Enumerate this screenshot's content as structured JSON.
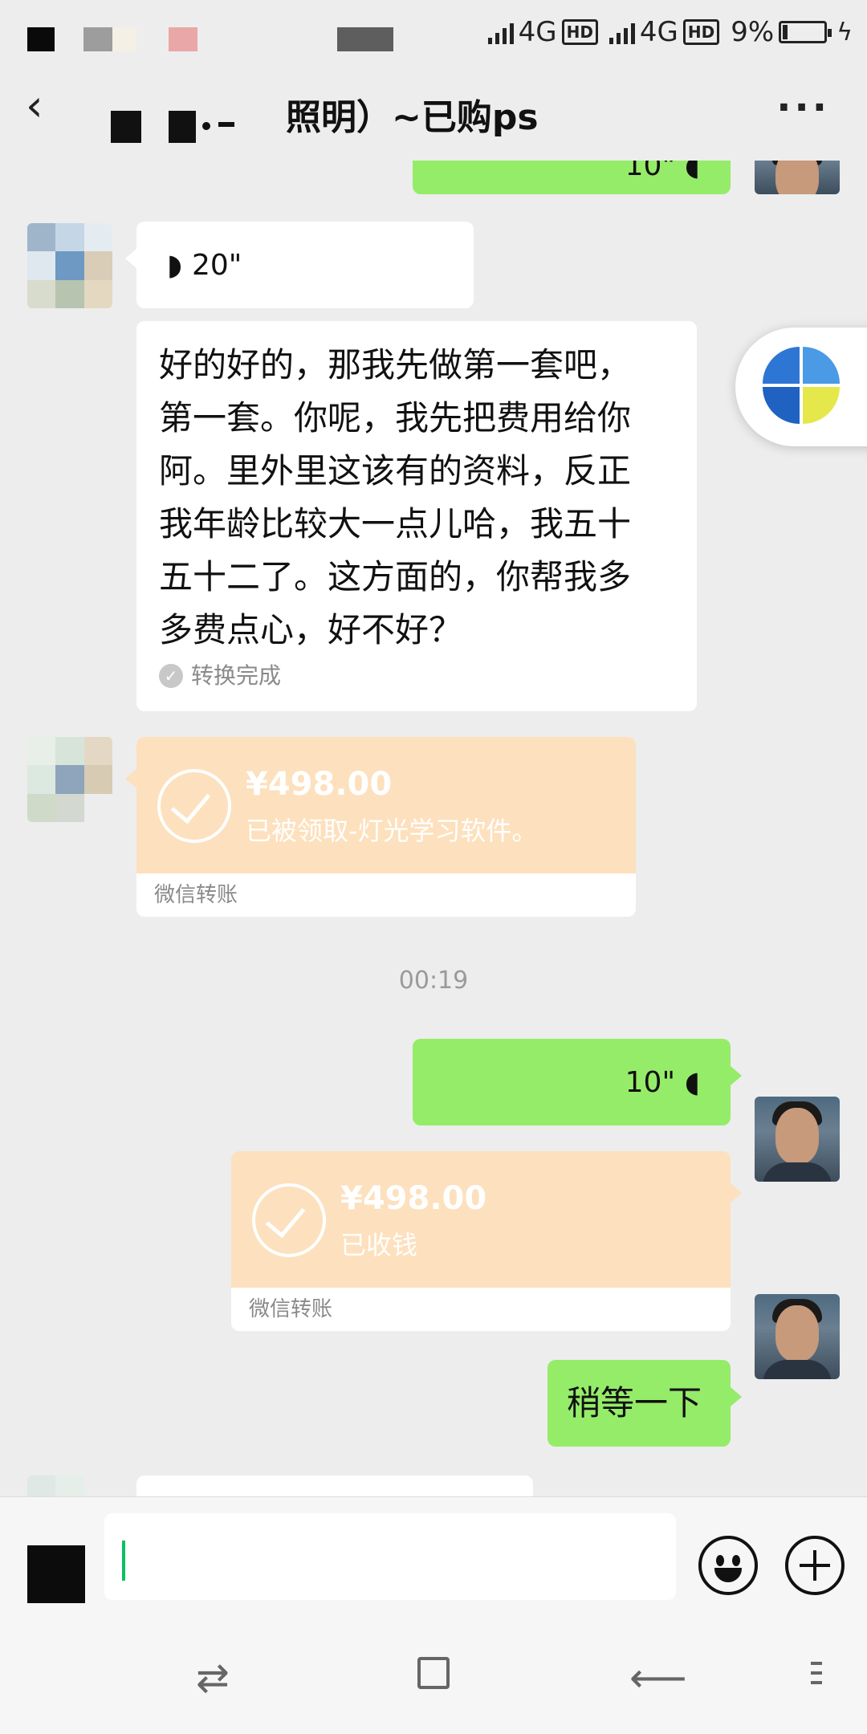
{
  "status_bar": {
    "network1": "4G",
    "hd1": "HD",
    "network2": "4G",
    "hd2": "HD",
    "battery_percent": "9%"
  },
  "title_bar": {
    "back_icon": "back-arrow-icon",
    "title": "照明）~已购ps",
    "more_label": "···"
  },
  "messages": {
    "voice_in": {
      "duration": "20\""
    },
    "text_in": {
      "lines": [
        "好的好的，那我先做第一套吧，",
        "第一套。你呢，我先把费用给你",
        "阿。里外里这该有的资料，反正",
        "我年龄比较大一点儿哈，我五十",
        "五十二了。这方面的，你帮我多",
        "多费点心，好不好？"
      ],
      "conversion_status": "转换完成"
    },
    "transfer_in": {
      "amount": "¥498.00",
      "note": "已被领取-灯光学习软件。",
      "footer": "微信转账"
    },
    "timestamp": "00:19",
    "voice_out": {
      "duration": "10\""
    },
    "transfer_out": {
      "amount": "¥498.00",
      "note": "已收钱",
      "footer": "微信转账"
    },
    "text_out": "稍等一下",
    "top_partial_voice_out": "10\""
  },
  "input_bar": {
    "voice_toggle_icon": "voice-keyboard-toggle-icon",
    "emoji_icon": "emoji-icon",
    "plus_icon": "plus-icon"
  },
  "nav_bar": {
    "switch_icon": "⇄",
    "back_icon": "⟵"
  },
  "colors": {
    "chat_background": "#ededed",
    "outgoing_bubble": "#95ec69",
    "transfer_card": "#fde0bd",
    "caret": "#07c160"
  }
}
